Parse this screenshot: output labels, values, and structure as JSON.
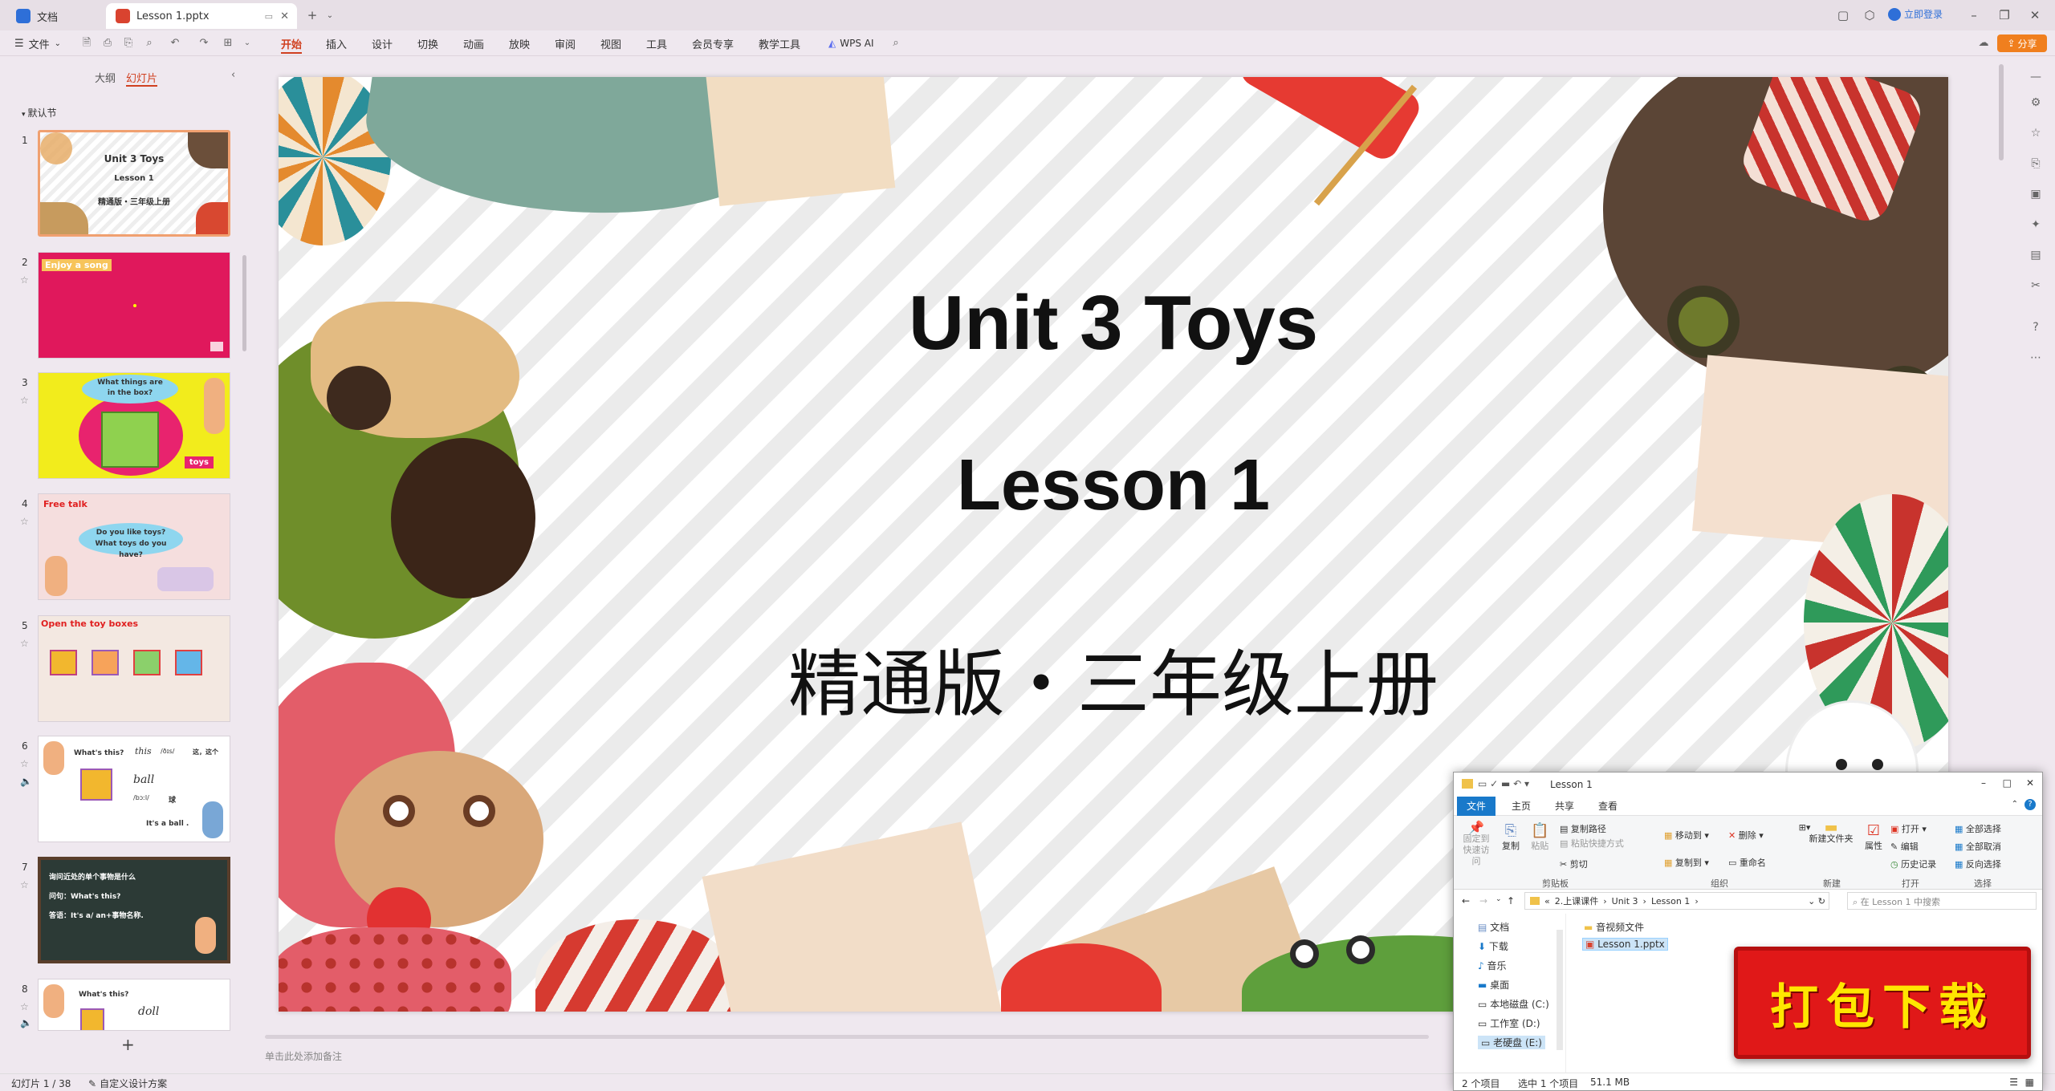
{
  "tabs": {
    "docs_label": "文档",
    "file_tab_label": "Lesson 1.pptx"
  },
  "titlebar": {
    "login_label": "立即登录"
  },
  "ribbon": {
    "file_menu": "文件",
    "menus": [
      "开始",
      "插入",
      "设计",
      "切换",
      "动画",
      "放映",
      "审阅",
      "视图",
      "工具",
      "会员专享",
      "教学工具"
    ],
    "wps_ai": "WPS AI",
    "share": "分享"
  },
  "panel": {
    "outline_tab": "大纲",
    "slides_tab": "幻灯片",
    "section_label": "默认节"
  },
  "thumbnails": {
    "t1": {
      "num": "1",
      "line1": "Unit 3  Toys",
      "line2": "Lesson 1",
      "line3": "精通版・三年级上册"
    },
    "t2": {
      "num": "2",
      "heading": "Enjoy a song"
    },
    "t3": {
      "num": "3",
      "bubble": "What things are in the box?",
      "tag": "toys"
    },
    "t4": {
      "num": "4",
      "heading": "Free talk",
      "bubble": "Do you like toys? What toys do you have?"
    },
    "t5": {
      "num": "5",
      "heading": "Open the toy boxes"
    },
    "t6": {
      "num": "6",
      "q": "What's this?",
      "w1": "this",
      "p1": "/ðɪs/",
      "m1": "这，这个",
      "w2": "ball",
      "p2": "/bɔːl/",
      "m2": "球",
      "a": "It's a ball ."
    },
    "t7": {
      "num": "7",
      "l1": "询问近处的单个事物是什么",
      "l2": "问句：What's this?",
      "l3": "答语：It's a/ an+事物名称."
    },
    "t8": {
      "num": "8",
      "q": "What's this?",
      "w": "doll"
    }
  },
  "slide": {
    "title1": "Unit 3  Toys",
    "title2": "Lesson 1",
    "subtitle": "精通版・三年级上册"
  },
  "notes_placeholder": "单击此处添加备注",
  "status": {
    "slide_count": "幻灯片 1 / 38",
    "design_scheme": "自定义设计方案"
  },
  "explorer": {
    "title": "Lesson 1",
    "tabs": [
      "文件",
      "主页",
      "共享",
      "查看"
    ],
    "buttons": {
      "pin": "固定到快速访问",
      "copy": "复制",
      "paste": "粘贴",
      "copy_path": "复制路径",
      "paste_shortcut": "粘贴快捷方式",
      "cut": "剪切",
      "move_to": "移动到",
      "copy_to": "复制到",
      "delete": "删除",
      "rename": "重命名",
      "new_folder": "新建文件夹",
      "properties": "属性",
      "open": "打开",
      "edit": "编辑",
      "history": "历史记录",
      "select_all": "全部选择",
      "select_none": "全部取消",
      "invert": "反向选择"
    },
    "groups": [
      "剪贴板",
      "组织",
      "新建",
      "打开",
      "选择"
    ],
    "breadcrumb": [
      "2.上课课件",
      "Unit 3",
      "Lesson 1"
    ],
    "search_placeholder": "在 Lesson 1 中搜索",
    "nav": [
      "文档",
      "下载",
      "音乐",
      "桌面",
      "本地磁盘 (C:)",
      "工作室 (D:)",
      "老硬盘 (E:)"
    ],
    "files": [
      "音视频文件",
      "Lesson 1.pptx"
    ],
    "item_count": "2 个项目",
    "selected": "选中 1 个项目",
    "size": "51.1 MB"
  },
  "download_badge": "打包下载",
  "colors": {
    "accent": "#d04020",
    "share_btn": "#f07f1e",
    "explorer_blue": "#1979ca",
    "badge_red": "#e01818"
  }
}
